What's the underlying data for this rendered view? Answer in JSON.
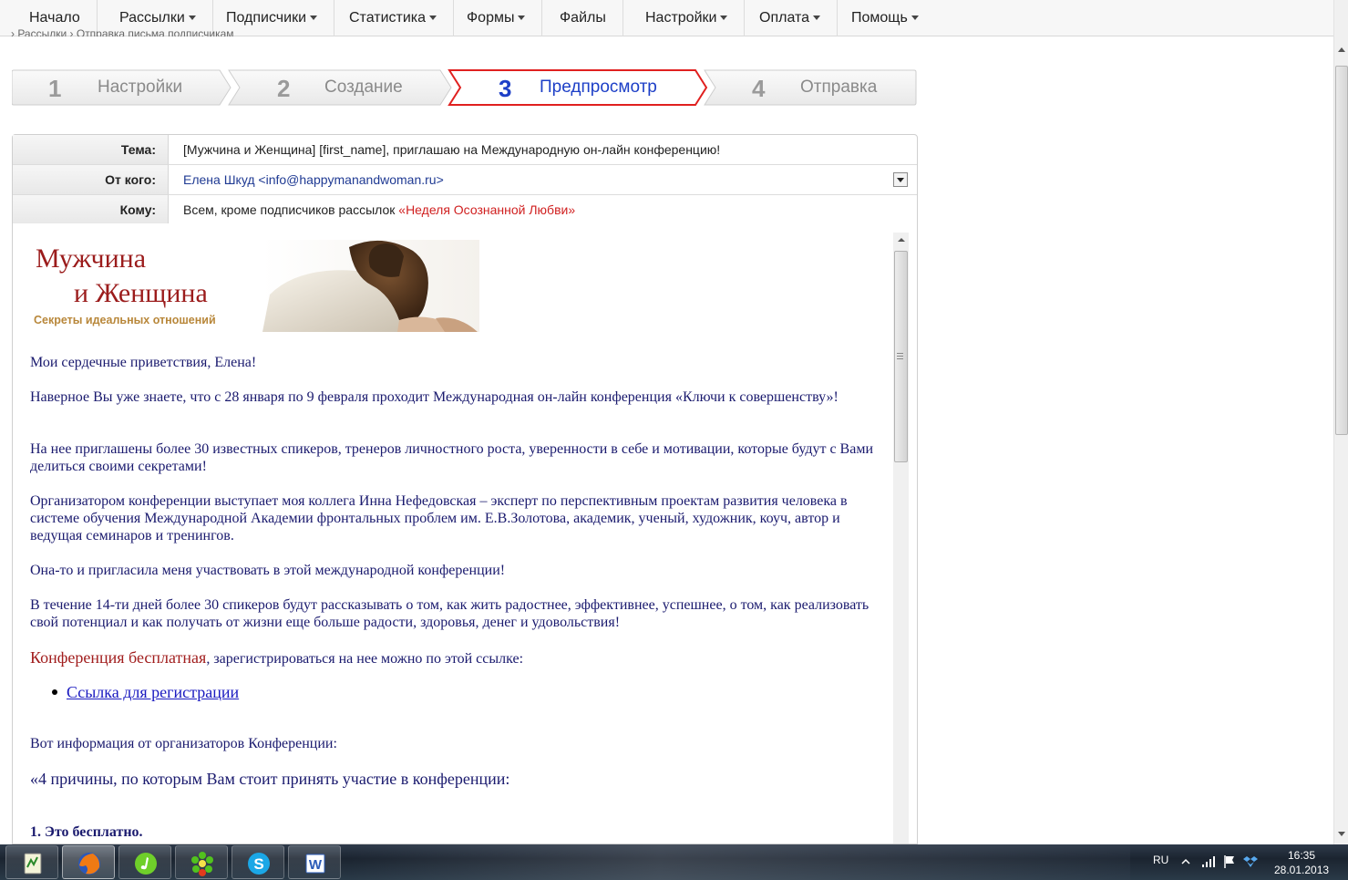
{
  "nav": {
    "items": [
      {
        "label": "Начало",
        "has_menu": false
      },
      {
        "label": "Рассылки",
        "has_menu": true
      },
      {
        "label": "Подписчики",
        "has_menu": true
      },
      {
        "label": "Статистика",
        "has_menu": true
      },
      {
        "label": "Формы",
        "has_menu": true
      },
      {
        "label": "Файлы",
        "has_menu": false
      },
      {
        "label": "Настройки",
        "has_menu": true
      },
      {
        "label": "Оплата",
        "has_menu": true
      },
      {
        "label": "Помощь",
        "has_menu": true
      }
    ]
  },
  "breadcrumb": "› Рассылки   › Отправка письма подписчикам",
  "wizard": {
    "steps": [
      {
        "num": "1",
        "label": "Настройки",
        "active": false
      },
      {
        "num": "2",
        "label": "Создание",
        "active": false
      },
      {
        "num": "3",
        "label": "Предпросмотр",
        "active": true
      },
      {
        "num": "4",
        "label": "Отправка",
        "active": false
      }
    ]
  },
  "header": {
    "subject_label": "Тема:",
    "subject_value": "[Мужчина и Женщина] [first_name], приглашаю на Международную он-лайн конференцию!",
    "from_label": "От кого:",
    "from_value": "Елена Шкуд <info@happymanandwoman.ru>",
    "to_label": "Кому:",
    "to_value_prefix": "Всем, кроме подписчиков рассылок ",
    "to_value_list": "«Неделя Осознанной Любви»"
  },
  "letter": {
    "banner_title_line1": "Мужчина",
    "banner_title_line2": "и Женщина",
    "banner_subtitle": "Секреты идеальных отношений",
    "greeting": "Мои сердечные приветствия, Елена!",
    "p1": "Наверное Вы уже знаете, что с 28 января по 9 февраля проходит Международная он-лайн конференция «Ключи к совершенству»!",
    "p2": "На нее приглашены более 30 известных спикеров, тренеров личностного роста, уверенности в себе и мотивации, которые будут с Вами делиться своими секретами!",
    "p3": "Организатором конференции выступает моя коллега Инна Нефедовская – эксперт по перспективным проектам развития человека в системе обучения Международной Академии фронтальных проблем им. Е.В.Золотова, академик, ученый, художник, коуч, автор и ведущая семинаров и тренингов.",
    "p4": "Она-то и пригласила меня участвовать в этой международной конференции!",
    "p5": "В течение 14-ти дней более 30 спикеров будут рассказывать о том, как жить радостнее, эффективнее, успешнее, о том, как реализовать свой потенциал и как получать от жизни еще больше радости, здоровья, денег и удовольствия!",
    "free_highlight": "Конференция бесплатная",
    "free_rest": ", зарегистрироваться на нее можно по этой ссылке:",
    "reg_link": "Ссылка для регистрации",
    "info_line": "Вот информация от организаторов Конференции:",
    "reasons_line": "«4 причины, по которым Вам стоит принять участие в конференции:",
    "reason1": "1. Это бесплатно."
  },
  "taskbar": {
    "apps": [
      "notepad-app-icon",
      "firefox-app-icon",
      "itunes-app-icon",
      "icq-app-icon",
      "skype-app-icon",
      "word-app-icon"
    ],
    "lang": "RU",
    "time": "16:35",
    "date": "28.01.2013"
  },
  "colors": {
    "accent_active_step": "#1d3fc7",
    "active_step_border": "#e0201f",
    "letter_text": "#1a1a6e",
    "letter_red": "#a11d1d",
    "logo_red": "#9b1c1c"
  }
}
